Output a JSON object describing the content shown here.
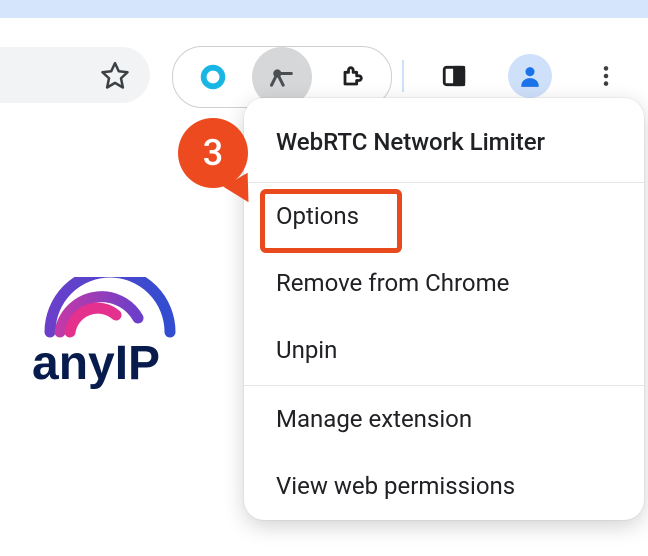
{
  "annotation": {
    "step": "3"
  },
  "context_menu": {
    "title": "WebRTC Network Limiter",
    "items": [
      {
        "label": "Options",
        "highlighted": true
      },
      {
        "label": "Remove from Chrome"
      },
      {
        "label": "Unpin"
      }
    ],
    "footer_items": [
      {
        "label": "Manage extension"
      },
      {
        "label": "View web permissions"
      }
    ]
  },
  "brand": {
    "name": "anyIP"
  },
  "toolbar": {
    "star": "bookmark-star",
    "extensions": [
      "circle",
      "limiter",
      "puzzle"
    ],
    "active_extension_index": 1
  },
  "colors": {
    "accent": "#ed4b1f",
    "profile_bg": "#cfe0fb",
    "brand_navy": "#071c4d",
    "brand_purple": "#6b3fc9",
    "brand_magenta": "#e4318e"
  }
}
